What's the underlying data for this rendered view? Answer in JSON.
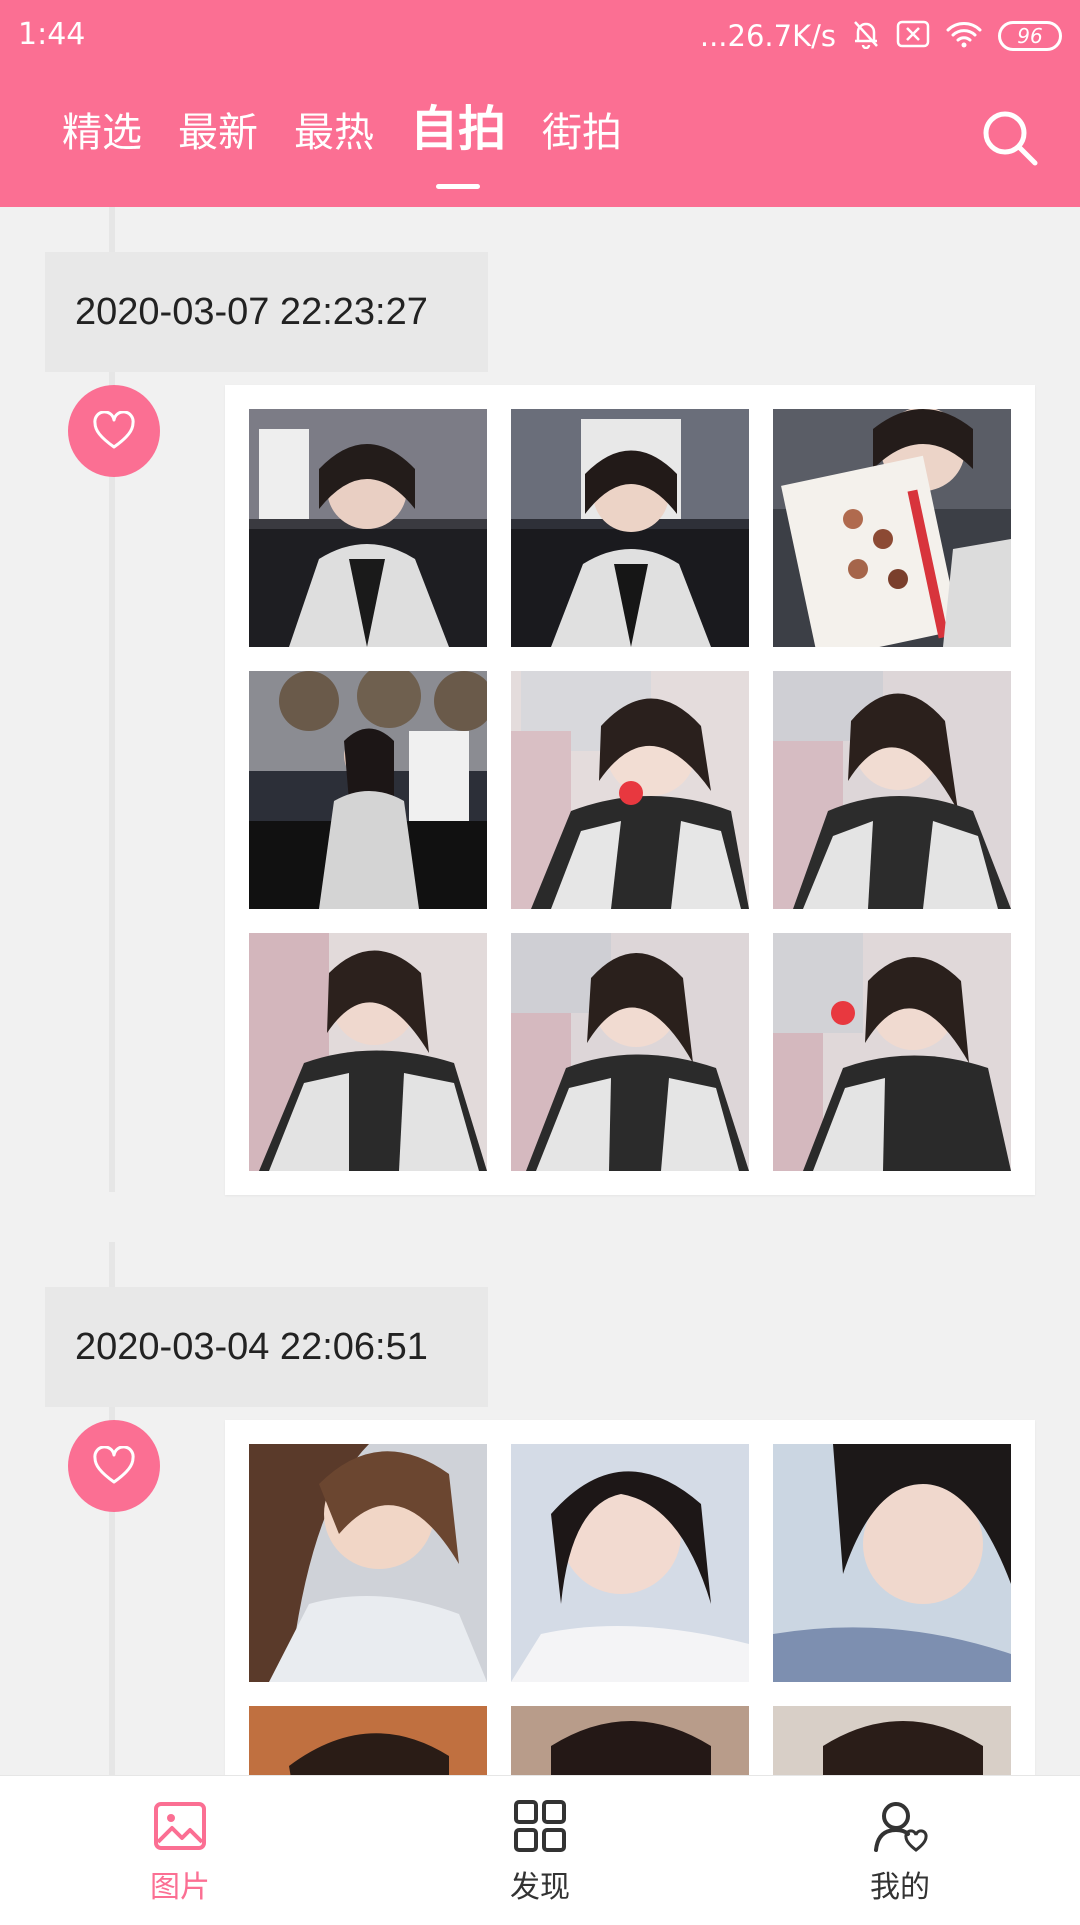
{
  "status": {
    "time": "1:44",
    "network": "...26.7K/s",
    "battery": "96"
  },
  "tabs": [
    {
      "label": "精选",
      "active": false
    },
    {
      "label": "最新",
      "active": false
    },
    {
      "label": "最热",
      "active": false
    },
    {
      "label": "自拍",
      "active": true
    },
    {
      "label": "街拍",
      "active": false
    }
  ],
  "posts": [
    {
      "date": "2020-03-07 22:23:27"
    },
    {
      "date": "2020-03-04 22:06:51"
    }
  ],
  "nav": [
    {
      "label": "图片",
      "icon": "image-icon",
      "active": true
    },
    {
      "label": "发现",
      "icon": "grid-icon",
      "active": false
    },
    {
      "label": "我的",
      "icon": "user-heart-icon",
      "active": false
    }
  ],
  "colors": {
    "accent": "#fb6f93"
  }
}
